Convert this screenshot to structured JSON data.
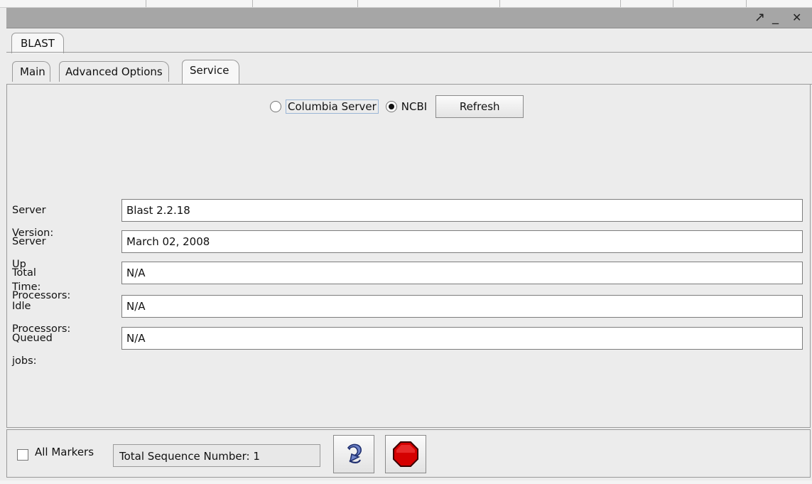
{
  "window": {
    "controls": {
      "maximize": "↗",
      "minimize": "_",
      "close": "✕"
    }
  },
  "outer_tabs": [
    {
      "label": "BLAST",
      "selected": true
    }
  ],
  "inner_tabs": [
    {
      "label": "Main",
      "selected": false
    },
    {
      "label": "Advanced Options",
      "selected": false
    },
    {
      "label": "Service",
      "selected": true
    }
  ],
  "service": {
    "server_options": [
      {
        "label": "Columbia Server",
        "selected": false
      },
      {
        "label": "NCBI",
        "selected": true
      }
    ],
    "refresh_label": "Refresh",
    "fields": [
      {
        "label": "Server Version:",
        "value": "Blast 2.2.18"
      },
      {
        "label": "Server Up Time:",
        "value": "March 02, 2008"
      },
      {
        "label": "Total Processors:",
        "value": "N/A"
      },
      {
        "label": "Idle Processors:",
        "value": "N/A"
      },
      {
        "label": "Queued jobs:",
        "value": "N/A"
      }
    ]
  },
  "bottom": {
    "all_markers_label": "All Markers",
    "all_markers_checked": false,
    "sequence_text": "Total Sequence Number: 1",
    "icons": [
      "refresh-icon",
      "stop-icon"
    ]
  },
  "colors": {
    "titlebar": "#a6a6a6",
    "stop_red": "#c00000"
  }
}
